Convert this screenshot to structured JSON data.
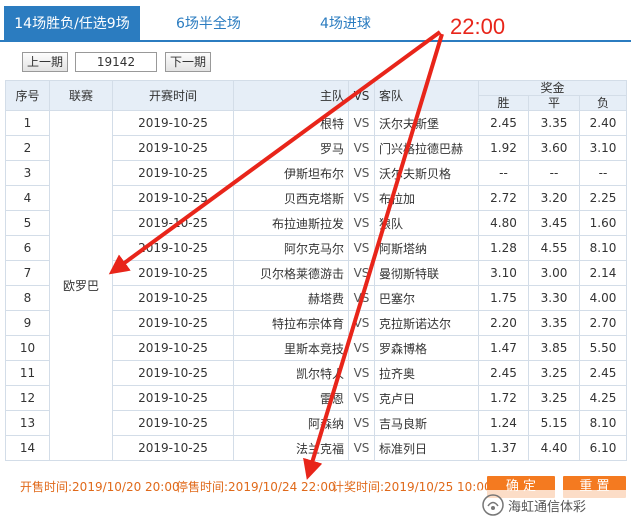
{
  "tabs": [
    {
      "label": "14场胜负/任选9场"
    },
    {
      "label": "6场半全场"
    },
    {
      "label": "4场进球"
    }
  ],
  "period": {
    "prev_label": "上一期",
    "current_value": "19142",
    "next_label": "下一期"
  },
  "table": {
    "headers": {
      "no": "序号",
      "league": "联赛",
      "time": "开赛时间",
      "home": "主队",
      "vs": "VS",
      "away": "客队",
      "prize": "奖金",
      "win": "胜",
      "draw": "平",
      "loss": "负"
    },
    "league": "欧罗巴",
    "rows": [
      {
        "no": "1",
        "time": "2019-10-25",
        "home": "根特",
        "vs": "VS",
        "away": "沃尔夫斯堡",
        "win": "2.45",
        "draw": "3.35",
        "loss": "2.40"
      },
      {
        "no": "2",
        "time": "2019-10-25",
        "home": "罗马",
        "vs": "VS",
        "away": "门兴格拉德巴赫",
        "win": "1.92",
        "draw": "3.60",
        "loss": "3.10"
      },
      {
        "no": "3",
        "time": "2019-10-25",
        "home": "伊斯坦布尔",
        "vs": "VS",
        "away": "沃尔夫斯贝格",
        "win": "--",
        "draw": "--",
        "loss": "--"
      },
      {
        "no": "4",
        "time": "2019-10-25",
        "home": "贝西克塔斯",
        "vs": "VS",
        "away": "布拉加",
        "win": "2.72",
        "draw": "3.20",
        "loss": "2.25"
      },
      {
        "no": "5",
        "time": "2019-10-25",
        "home": "布拉迪斯拉发",
        "vs": "VS",
        "away": "狼队",
        "win": "4.80",
        "draw": "3.45",
        "loss": "1.60"
      },
      {
        "no": "6",
        "time": "2019-10-25",
        "home": "阿尔克马尔",
        "vs": "VS",
        "away": "阿斯塔纳",
        "win": "1.28",
        "draw": "4.55",
        "loss": "8.10"
      },
      {
        "no": "7",
        "time": "2019-10-25",
        "home": "贝尔格莱德游击",
        "vs": "VS",
        "away": "曼彻斯特联",
        "win": "3.10",
        "draw": "3.00",
        "loss": "2.14"
      },
      {
        "no": "8",
        "time": "2019-10-25",
        "home": "赫塔费",
        "vs": "VS",
        "away": "巴塞尔",
        "win": "1.75",
        "draw": "3.30",
        "loss": "4.00"
      },
      {
        "no": "9",
        "time": "2019-10-25",
        "home": "特拉布宗体育",
        "vs": "VS",
        "away": "克拉斯诺达尔",
        "win": "2.20",
        "draw": "3.35",
        "loss": "2.70"
      },
      {
        "no": "10",
        "time": "2019-10-25",
        "home": "里斯本竞技",
        "vs": "VS",
        "away": "罗森博格",
        "win": "1.47",
        "draw": "3.85",
        "loss": "5.50"
      },
      {
        "no": "11",
        "time": "2019-10-25",
        "home": "凯尔特人",
        "vs": "VS",
        "away": "拉齐奥",
        "win": "2.45",
        "draw": "3.25",
        "loss": "2.45"
      },
      {
        "no": "12",
        "time": "2019-10-25",
        "home": "雷恩",
        "vs": "VS",
        "away": "克卢日",
        "win": "1.72",
        "draw": "3.25",
        "loss": "4.25"
      },
      {
        "no": "13",
        "time": "2019-10-25",
        "home": "阿森纳",
        "vs": "VS",
        "away": "吉马良斯",
        "win": "1.24",
        "draw": "5.15",
        "loss": "8.10"
      },
      {
        "no": "14",
        "time": "2019-10-25",
        "home": "法兰克福",
        "vs": "VS",
        "away": "标准列日",
        "win": "1.37",
        "draw": "4.40",
        "loss": "6.10"
      }
    ]
  },
  "footer": {
    "sale_start": "开售时间:2019/10/20 20:00",
    "sale_stop": "停售时间:2019/10/24 22:00",
    "draw_time": "计奖时间:2019/10/25 10:00",
    "confirm_label": "确 定",
    "reset_label": "重 置"
  },
  "annotation": {
    "time_label": "22:00",
    "color": "#e8251a"
  },
  "watermark": {
    "text": "海虹通信体彩"
  },
  "colors": {
    "accent": "#2b7cc0",
    "header_bg": "#e6eef7",
    "footer_text": "#e06a1b",
    "button": "#f47a20"
  }
}
